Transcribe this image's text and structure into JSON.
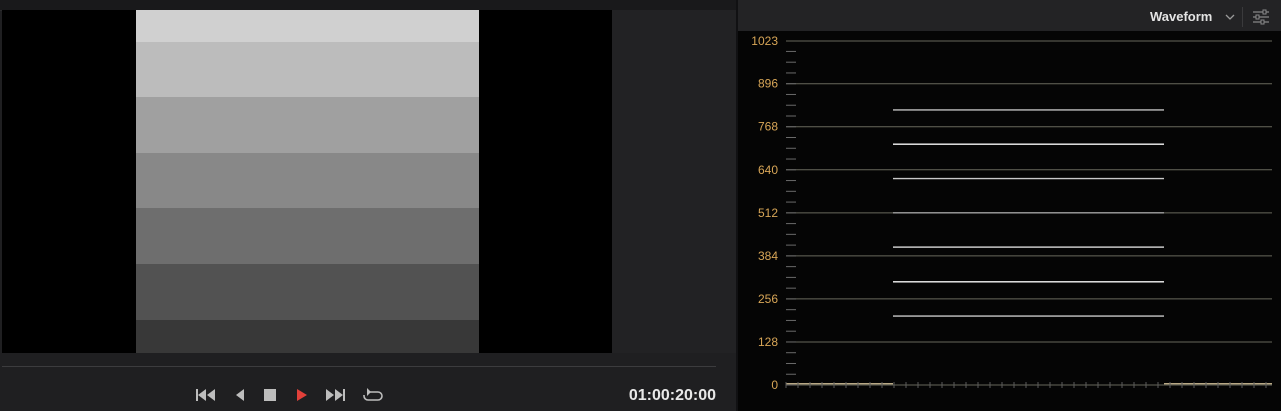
{
  "viewer": {
    "timecode": "01:00:20:00",
    "chart_bands": [
      "#d0d0d0",
      "#bcbcbc",
      "#a0a0a0",
      "#888888",
      "#6e6e6e",
      "#525252",
      "#383838"
    ],
    "transport": {
      "first_frame_icon": "skip-to-start-icon",
      "reverse_icon": "play-reverse-icon",
      "stop_icon": "stop-icon",
      "play_icon": "play-icon",
      "last_frame_icon": "skip-to-end-icon",
      "loop_icon": "loop-icon",
      "play_color": "#e2403a",
      "icon_color": "#bdbdbd"
    }
  },
  "scope": {
    "title": "Waveform",
    "settings_icon": "sliders-icon",
    "chevron_icon": "chevron-down-icon",
    "label_color": "#d8a657",
    "grid_color": "#8a8a7a"
  },
  "chart_data": {
    "type": "waveform",
    "y_scale_labels": [
      "1023",
      "896",
      "768",
      "640",
      "512",
      "384",
      "256",
      "128",
      "0"
    ],
    "ylim": [
      0,
      1023
    ],
    "grid": true,
    "traces": [
      {
        "level": 818,
        "brightness": 0.55
      },
      {
        "level": 716,
        "brightness": 0.95
      },
      {
        "level": 614,
        "brightness": 0.6
      },
      {
        "level": 512,
        "brightness": 0.3
      },
      {
        "level": 410,
        "brightness": 0.6
      },
      {
        "level": 307,
        "brightness": 0.95
      },
      {
        "level": 205,
        "brightness": 0.6
      }
    ],
    "black_level": 4
  }
}
